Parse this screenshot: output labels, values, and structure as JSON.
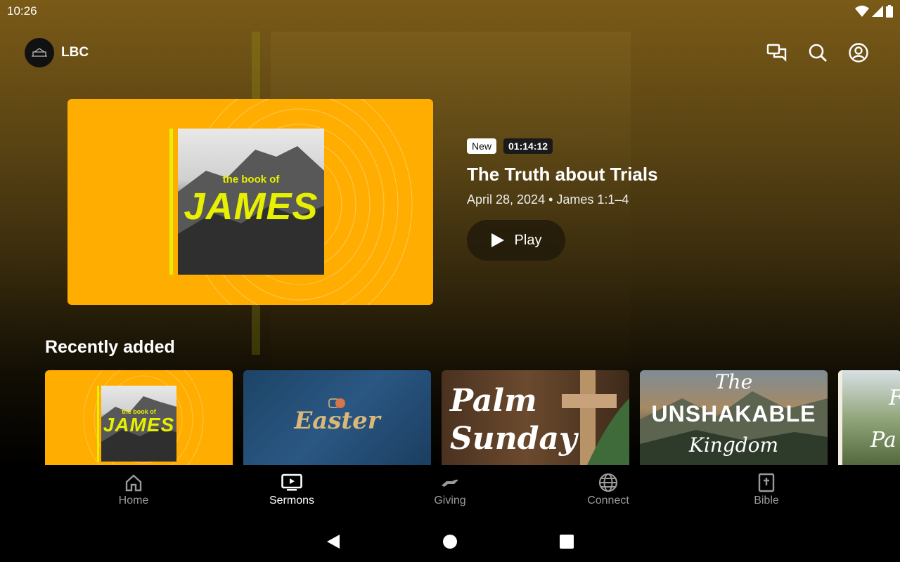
{
  "status_bar": {
    "time": "10:26"
  },
  "app": {
    "brand_name": "LBC"
  },
  "hero": {
    "cover_line1": "the book of",
    "cover_line2": "JAMES",
    "badge_new": "New",
    "duration": "01:14:12",
    "title": "The Truth about Trials",
    "meta": "April 28, 2024 • James 1:1–4",
    "play_label": "Play"
  },
  "recently_added": {
    "title": "Recently added",
    "items": [
      {
        "line1": "the book of",
        "line2": "JAMES"
      },
      {
        "line1": "Easter"
      },
      {
        "line1": "Palm",
        "line2": "Sunday"
      },
      {
        "line1": "The",
        "line2": "UNSHAKABLE",
        "line3": "Kingdom"
      },
      {
        "line1": "F",
        "line2": "Pa"
      }
    ]
  },
  "bottom_nav": {
    "items": [
      {
        "label": "Home",
        "icon": "home-icon"
      },
      {
        "label": "Sermons",
        "icon": "tv-icon",
        "active": true
      },
      {
        "label": "Giving",
        "icon": "giving-icon"
      },
      {
        "label": "Connect",
        "icon": "globe-icon"
      },
      {
        "label": "Bible",
        "icon": "bible-icon"
      }
    ]
  },
  "colors": {
    "hero_card": "#ffad00",
    "accent_yellow": "#e6f000",
    "nav_active": "#ffffff",
    "nav_inactive": "#9a9a9a"
  }
}
